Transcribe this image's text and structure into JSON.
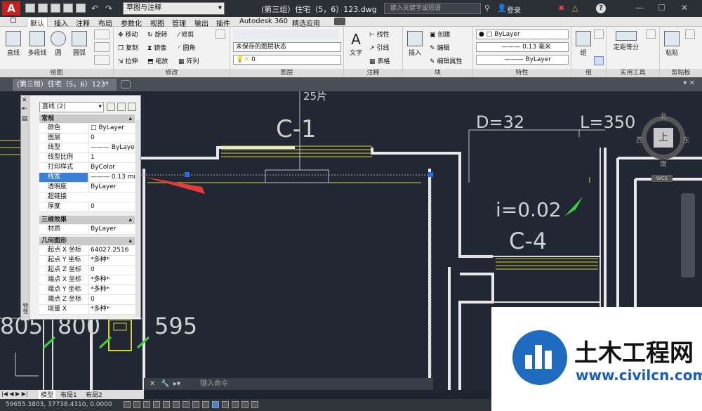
{
  "titlebar": {
    "logo": "A",
    "workspace": "草图与注释",
    "doc_title": "(第三组）住宅（5，6）123.dwg",
    "search_placeholder": "键入关键字或短语",
    "login": "登录",
    "help": "?"
  },
  "ribbon_tabs": [
    "默认",
    "插入",
    "注释",
    "布局",
    "参数化",
    "视图",
    "管理",
    "输出",
    "插件",
    "Autodesk 360",
    "精选应用"
  ],
  "ribbon": {
    "draw": {
      "label": "绘图",
      "line": "直线",
      "polyline": "多段线",
      "circle": "圆",
      "arc": "圆弧"
    },
    "modify": {
      "label": "修改",
      "move": "移动",
      "rotate": "旋转",
      "trim": "修剪",
      "copy": "复制",
      "mirror": "镜像",
      "fillet": "圆角",
      "stretch": "拉伸",
      "scale": "缩放",
      "array": "阵列"
    },
    "layer": {
      "label": "图层",
      "state": "未保存的图层状态",
      "current": "0"
    },
    "annotation": {
      "label": "注释",
      "text": "文字",
      "linear": "线性",
      "leader": "引线",
      "table": "表格"
    },
    "block": {
      "label": "块",
      "insert": "插入",
      "create": "创建",
      "edit": "编辑",
      "edit_attr": "编辑属性"
    },
    "properties": {
      "label": "特性",
      "color": "ByLayer",
      "lineweight": "0.13 毫米",
      "linetype": "ByLayer"
    },
    "group": {
      "label": "组",
      "group": "组"
    },
    "utilities": {
      "label": "实用工具",
      "measure": "定距等分"
    },
    "clipboard": {
      "label": "剪贴板",
      "paste": "粘贴"
    }
  },
  "doc_tab": "(第三组）住宅（5，6）123*",
  "properties_panel": {
    "title": "特性",
    "selection": "直线 (2)",
    "sections": {
      "general": "常规",
      "three_d": "三维效果",
      "geometry": "几何图形"
    },
    "general_rows": [
      {
        "k": "颜色",
        "v": "□ ByLayer"
      },
      {
        "k": "图层",
        "v": "0"
      },
      {
        "k": "线型",
        "v": "——— ByLayer"
      },
      {
        "k": "线型比例",
        "v": "1"
      },
      {
        "k": "打印样式",
        "v": "ByColor"
      },
      {
        "k": "线宽",
        "v": "——— 0.13 mm"
      },
      {
        "k": "透明度",
        "v": "ByLayer"
      },
      {
        "k": "超链接",
        "v": ""
      },
      {
        "k": "厚度",
        "v": "0"
      }
    ],
    "three_d_rows": [
      {
        "k": "材质",
        "v": "ByLayer"
      }
    ],
    "geometry_rows": [
      {
        "k": "起点 X 坐标",
        "v": "64027.2516"
      },
      {
        "k": "起点 Y 坐标",
        "v": "*多种*"
      },
      {
        "k": "起点 Z 坐标",
        "v": "0"
      },
      {
        "k": "端点 X 坐标",
        "v": "*多种*"
      },
      {
        "k": "端点 Y 坐标",
        "v": "*多种*"
      },
      {
        "k": "端点 Z 坐标",
        "v": "0"
      },
      {
        "k": "增量 X",
        "v": "*多种*"
      }
    ]
  },
  "drawing": {
    "label_c1": "C-1",
    "label_25": "25片",
    "label_d": "D=32",
    "label_l": "L=350",
    "label_i": "i=0.02",
    "label_c4": "C-4",
    "dim_805": "805",
    "dim_800": "800",
    "dim_595": "595"
  },
  "viewcube": {
    "n": "北",
    "s": "南",
    "e": "东",
    "w": "西",
    "top": "上",
    "wcs": "WCS"
  },
  "command_placeholder": "键入命令",
  "layout_tabs": [
    "模型",
    "布局1",
    "布局2"
  ],
  "status_coords": "59655.3803, 37738.4310, 0.0000",
  "watermark": {
    "title": "土木工程网",
    "url": "www.civilcn.com"
  }
}
